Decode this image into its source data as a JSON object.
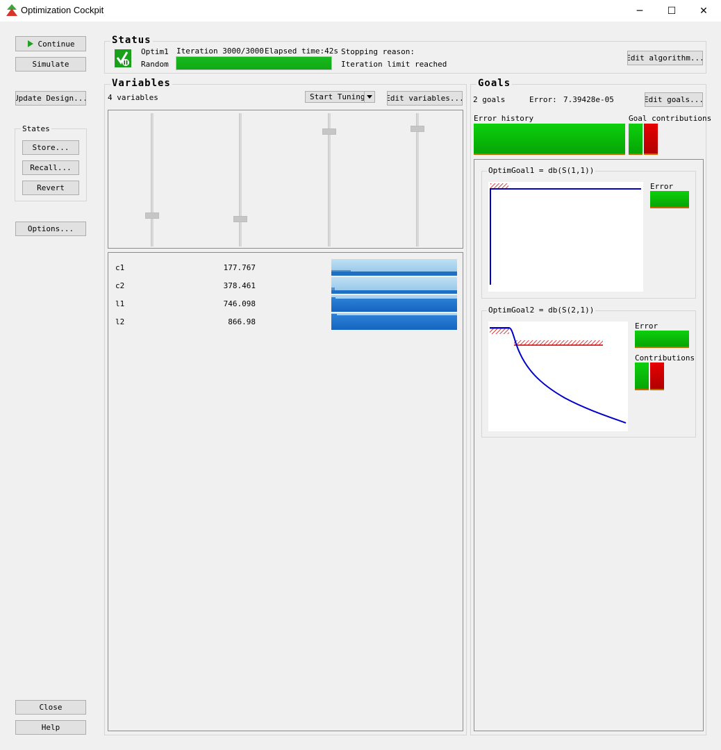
{
  "window": {
    "title": "Optimization Cockpit",
    "minimize": "─",
    "maximize": "☐",
    "close": "✕"
  },
  "sidebar": {
    "continue": "Continue",
    "simulate": "Simulate",
    "update_design": "Update Design...",
    "states_title": "States",
    "store": "Store...",
    "recall": "Recall...",
    "revert": "Revert",
    "options": "Options...",
    "close": "Close",
    "help": "Help"
  },
  "status": {
    "title": "Status",
    "optimizer": "Optim1",
    "method": "Random",
    "iteration": "Iteration 3000/3000",
    "elapsed": "Elapsed time:42s",
    "progress": 1.0,
    "stopping_label": "Stopping reason:",
    "stopping_reason": "Iteration limit reached",
    "edit_algorithm": "Edit algorithm..."
  },
  "variables": {
    "title": "Variables",
    "count_label": "4 variables",
    "start_tuning": "Start Tuning",
    "edit_variables": "Edit variables...",
    "sliders": [
      0.22,
      0.19,
      0.88,
      0.9
    ],
    "rows": [
      {
        "name": "c1",
        "value": "177.767"
      },
      {
        "name": "c2",
        "value": "378.461"
      },
      {
        "name": "l1",
        "value": "746.098"
      },
      {
        "name": "l2",
        "value": "866.98"
      }
    ]
  },
  "goals": {
    "title": "Goals",
    "count_label": "2 goals",
    "error_label": "Error:",
    "error_value": "7.39428e-05",
    "edit_goals": "Edit goals...",
    "error_history_label": "Error history",
    "goal_contrib_label": "Goal contributions",
    "goal1": {
      "title": "OptimGoal1 = db(S(1,1))",
      "error_label": "Error"
    },
    "goal2": {
      "title": "OptimGoal2 = db(S(2,1))",
      "error_label": "Error",
      "contrib_label": "Contributions"
    },
    "colors": {
      "curve": "#0000c8",
      "spec": "#c80000",
      "ok": "#0dcf0d",
      "bad": "#e60000"
    }
  }
}
